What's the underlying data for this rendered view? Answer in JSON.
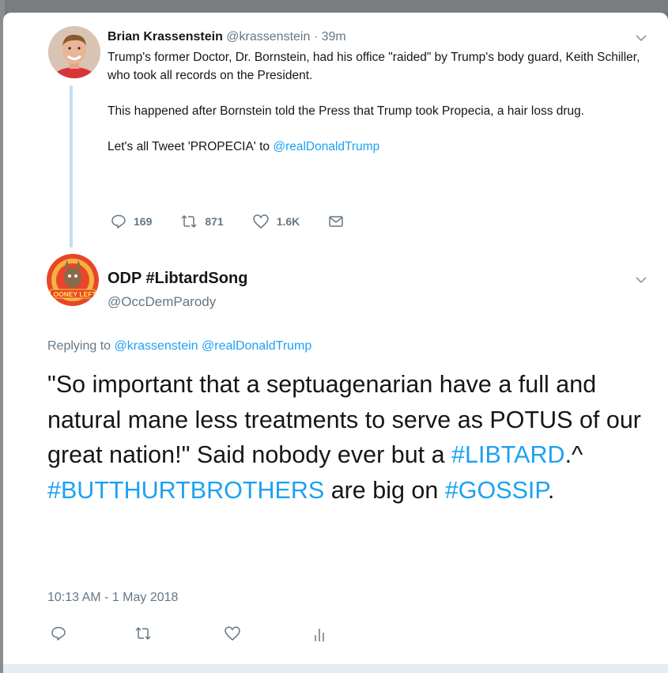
{
  "tweet1": {
    "name": "Brian Krassenstein",
    "handle": "@krassenstein",
    "sep": "·",
    "time": "39m",
    "para1": "Trump's former Doctor, Dr. Bornstein, had his office \"raided\" by Trump's body guard, Keith Schiller, who took all records on the President.",
    "para2": "This happened after Bornstein told the Press that Trump took Propecia, a hair loss drug.",
    "para3_prefix": "Let's all Tweet 'PROPECIA' to ",
    "para3_mention": "@realDonaldTrump",
    "replies": "169",
    "retweets": "871",
    "likes": "1.6K"
  },
  "tweet2": {
    "name": "ODP #LibtardSong",
    "handle": "@OccDemParody",
    "avatar_text": "LOONEY LEFT",
    "replying_prefix": "Replying to ",
    "replying_to_1": "@krassenstein",
    "replying_to_2": "@realDonaldTrump",
    "text_1": "\"So important that a septuagenarian have a full and natural mane less treatments to serve as POTUS of our great nation!\" Said nobody ever but a ",
    "hashtag_1": "#LIBTARD",
    "text_2": ".^ ",
    "hashtag_2": "#BUTTHURTBROTHERS",
    "text_3": " are big on ",
    "hashtag_3": "#GOSSIP",
    "text_4": ".",
    "timestamp": "10:13 AM - 1 May 2018"
  },
  "colors": {
    "link": "#1da1f2",
    "secondary_text": "#657786",
    "thread_line": "#c3def3"
  }
}
